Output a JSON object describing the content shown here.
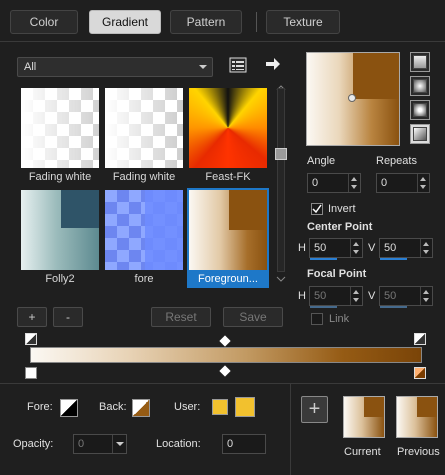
{
  "tabs": [
    {
      "label": "Color"
    },
    {
      "label": "Gradient"
    },
    {
      "label": "Pattern"
    },
    {
      "label": "Texture"
    }
  ],
  "category_dropdown": {
    "value": "All"
  },
  "gradients": [
    {
      "caption": "Fading white"
    },
    {
      "caption": "Fading white"
    },
    {
      "caption": "Feast-FK"
    },
    {
      "caption": "Folly2"
    },
    {
      "caption": "fore"
    },
    {
      "caption": "Foregroun..."
    }
  ],
  "list_buttons": {
    "add": "+",
    "remove": "-",
    "reset": "Reset",
    "save": "Save"
  },
  "angle": {
    "label": "Angle",
    "value": "0"
  },
  "repeats": {
    "label": "Repeats",
    "value": "0"
  },
  "invert": {
    "label": "Invert",
    "checked": true
  },
  "center_point": {
    "title": "Center Point",
    "h_label": "H",
    "h_value": "50",
    "v_label": "V",
    "v_value": "50"
  },
  "focal_point": {
    "title": "Focal Point",
    "h_label": "H",
    "h_value": "50",
    "v_label": "V",
    "v_value": "50"
  },
  "link": {
    "label": "Link",
    "checked": false
  },
  "bottom": {
    "fore_label": "Fore:",
    "back_label": "Back:",
    "user_label": "User:",
    "opacity_label": "Opacity:",
    "opacity_value": "0",
    "location_label": "Location:",
    "location_value": "0",
    "add_symbol": "+",
    "current_label": "Current",
    "previous_label": "Previous"
  },
  "colors": {
    "accent": "#1e78c8",
    "brown": "#955b14",
    "user": "#f2c12e",
    "light": "#fbf8f3"
  }
}
